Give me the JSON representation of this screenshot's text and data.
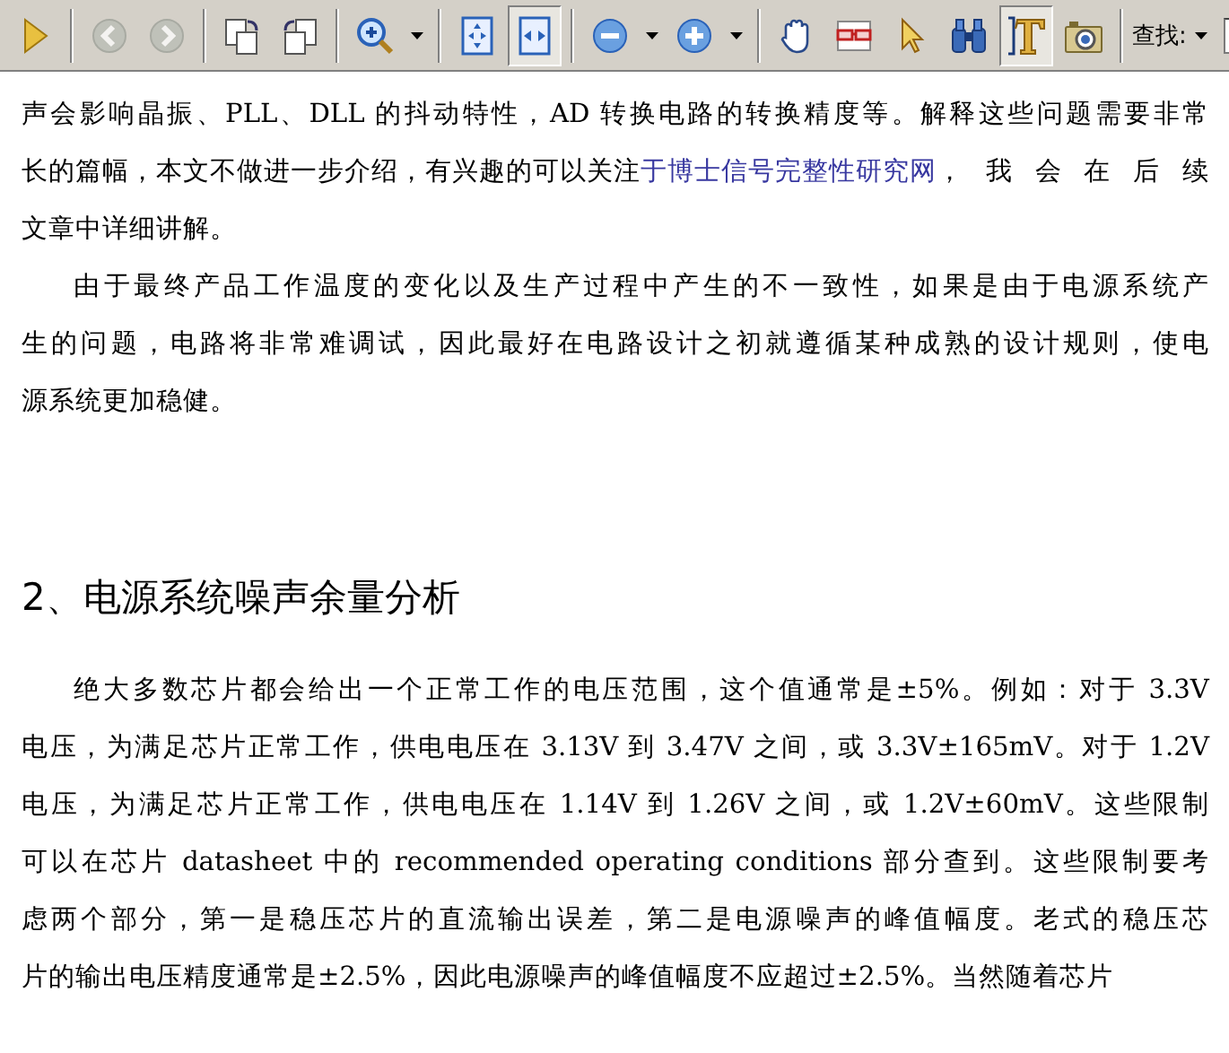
{
  "toolbar": {
    "tools": [
      {
        "kind": "play",
        "selected": false,
        "disabled": false
      },
      {
        "kind": "back",
        "selected": false,
        "disabled": true
      },
      {
        "kind": "forward",
        "selected": false,
        "disabled": true
      },
      {
        "kind": "rotatecw",
        "selected": false,
        "disabled": false
      },
      {
        "kind": "rotateccw",
        "selected": false,
        "disabled": false
      },
      {
        "kind": "zoomtool",
        "selected": false,
        "disabled": false,
        "menu": true
      },
      {
        "kind": "fitpage",
        "selected": false,
        "disabled": false
      },
      {
        "kind": "fitwidth",
        "selected": true,
        "disabled": false
      },
      {
        "kind": "zoomout",
        "selected": false,
        "disabled": false,
        "menu": true
      },
      {
        "kind": "zoomin",
        "selected": false,
        "disabled": false,
        "menu": true
      },
      {
        "kind": "hand",
        "selected": false,
        "disabled": false
      },
      {
        "kind": "glasses",
        "selected": false,
        "disabled": false
      },
      {
        "kind": "pointer",
        "selected": false,
        "disabled": false
      },
      {
        "kind": "binoculars",
        "selected": false,
        "disabled": false
      },
      {
        "kind": "textselect",
        "selected": true,
        "disabled": false
      },
      {
        "kind": "camera",
        "selected": false,
        "disabled": false
      }
    ],
    "search": {
      "label": "查找:"
    }
  },
  "document": {
    "blocks": [
      {
        "kind": "paragraph",
        "indent": false,
        "lines": [
          [
            {
              "kind": "text",
              "text": "声会影响晶振、PLL、DLL 的抖动特性，AD 转换电路的转换精度等。解释这些问题需要非常"
            }
          ],
          [
            {
              "kind": "text",
              "text": "长的篇幅，本文不做进一步介绍，有兴趣的可以关注"
            },
            {
              "kind": "link",
              "text": "于博士信号完整性研究网"
            },
            {
              "kind": "text",
              "text": "，我会在后续"
            }
          ],
          [
            {
              "kind": "text",
              "text": "文章中详细讲解。"
            }
          ]
        ]
      },
      {
        "kind": "paragraph",
        "indent": true,
        "lines": [
          [
            {
              "kind": "text",
              "text": "由于最终产品工作温度的变化以及生产过程中产生的不一致性，如果是由于电源系统产"
            }
          ],
          [
            {
              "kind": "text",
              "text": "生的问题，电路将非常难调试，因此最好在电路设计之初就遵循某种成熟的设计规则，使电"
            }
          ],
          [
            {
              "kind": "text",
              "text": "源系统更加稳健。"
            }
          ]
        ]
      },
      {
        "kind": "heading",
        "text": "2、电源系统噪声余量分析"
      },
      {
        "kind": "paragraph",
        "indent": true,
        "lines": [
          [
            {
              "kind": "text",
              "text": "绝大多数芯片都会给出一个正常工作的电压范围，这个值通常是±5%。例如：对于 3.3V"
            }
          ],
          [
            {
              "kind": "text",
              "text": "电压，为满足芯片正常工作，供电电压在 3.13V 到 3.47V 之间，或 3.3V±165mV。对于 1.2V"
            }
          ],
          [
            {
              "kind": "text",
              "text": "电压，为满足芯片正常工作，供电电压在 1.14V 到 1.26V 之间，或 1.2V±60mV。这些限制"
            }
          ],
          [
            {
              "kind": "text",
              "text": "可以在芯片 datasheet 中的 recommended operating conditions 部分查到。这些限制要考"
            }
          ],
          [
            {
              "kind": "text",
              "text": "虑两个部分，第一是稳压芯片的直流输出误差，第二是电源噪声的峰值幅度。老式的稳压芯"
            }
          ],
          [
            {
              "kind": "text",
              "text": "片的输出电压精度通常是±2.5%，因此电源噪声的峰值幅度不应超过±2.5%。当然随着芯片"
            }
          ]
        ]
      }
    ]
  }
}
